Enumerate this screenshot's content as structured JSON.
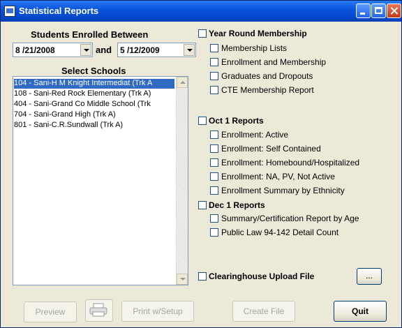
{
  "window": {
    "title": "Statistical Reports"
  },
  "dates": {
    "label": "Students Enrolled Between",
    "start": "8 /21/2008",
    "and_label": "and",
    "end": "5 /12/2009"
  },
  "schools": {
    "label": "Select Schools",
    "items": [
      "104 - Sani-H M Knight Intermediat (Trk A",
      "108 - Sani-Red Rock Elementary (Trk A)",
      "404 - Sani-Grand Co Middle School (Trk",
      "704 - Sani-Grand High (Trk A)",
      "801 - Sani-C.R.Sundwall (Trk A)"
    ]
  },
  "year_round": {
    "label": "Year Round Membership",
    "items": [
      "Membership Lists",
      "Enrollment and Membership",
      "Graduates and Dropouts",
      "CTE Membership Report"
    ]
  },
  "oct1": {
    "label": "Oct 1 Reports",
    "items": [
      "Enrollment: Active",
      "Enrollment: Self Contained",
      "Enrollment: Homebound/Hospitalized",
      "Enrollment: NA, PV, Not Active",
      "Enrollment Summary by Ethnicity"
    ]
  },
  "dec1": {
    "label": "Dec 1 Reports",
    "items": [
      "Summary/Certification Report by Age",
      "Public Law 94-142 Detail Count"
    ]
  },
  "clearinghouse": {
    "label": "Clearinghouse Upload File",
    "browse_label": "..."
  },
  "buttons": {
    "preview": "Preview",
    "print_setup": "Print w/Setup",
    "create_file": "Create File",
    "quit": "Quit"
  }
}
